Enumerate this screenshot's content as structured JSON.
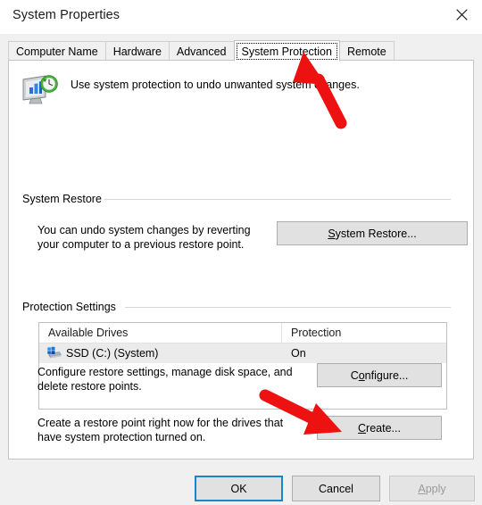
{
  "window": {
    "title": "System Properties",
    "close_icon": "close-icon"
  },
  "tabs": [
    {
      "label": "Computer Name",
      "active": false
    },
    {
      "label": "Hardware",
      "active": false
    },
    {
      "label": "Advanced",
      "active": false
    },
    {
      "label": "System Protection",
      "active": true
    },
    {
      "label": "Remote",
      "active": false
    }
  ],
  "header": {
    "icon": "system-protection-icon",
    "description": "Use system protection to undo unwanted system changes."
  },
  "system_restore": {
    "group_label": "System Restore",
    "description_line1": "You can undo system changes by reverting",
    "description_line2": "your computer to a previous restore point.",
    "button_accesskey": "S",
    "button_rest": "ystem Restore..."
  },
  "protection_settings": {
    "group_label": "Protection Settings",
    "columns": [
      "Available Drives",
      "Protection"
    ],
    "rows": [
      {
        "drive": "SSD (C:) (System)",
        "protection": "On",
        "icon": "system-drive-icon",
        "selected": true
      }
    ],
    "configure": {
      "description_line1": "Configure restore settings, manage disk space, and",
      "description_line2": "delete restore points.",
      "button_pre": "C",
      "button_accesskey": "o",
      "button_rest": "nfigure..."
    },
    "create": {
      "description_line1": "Create a restore point right now for the drives that",
      "description_line2": "have system protection turned on.",
      "button_accesskey": "C",
      "button_rest": "reate..."
    }
  },
  "footer": {
    "ok": "OK",
    "cancel": "Cancel",
    "apply_accesskey": "A",
    "apply_rest": "pply",
    "apply_disabled": true
  },
  "annotations": [
    {
      "name": "arrow-to-system-protection-tab",
      "color": "#ee1111",
      "direction": "up-left",
      "target": "System Protection tab"
    },
    {
      "name": "arrow-to-create-button",
      "color": "#ee1111",
      "direction": "down-right",
      "target": "Create... button"
    }
  ],
  "colors": {
    "accent_blue": "#1a86c8",
    "annotation_red": "#ee1111",
    "window_bg": "#f0f0f0",
    "panel_bg": "#ffffff",
    "button_face": "#e1e1e1"
  }
}
